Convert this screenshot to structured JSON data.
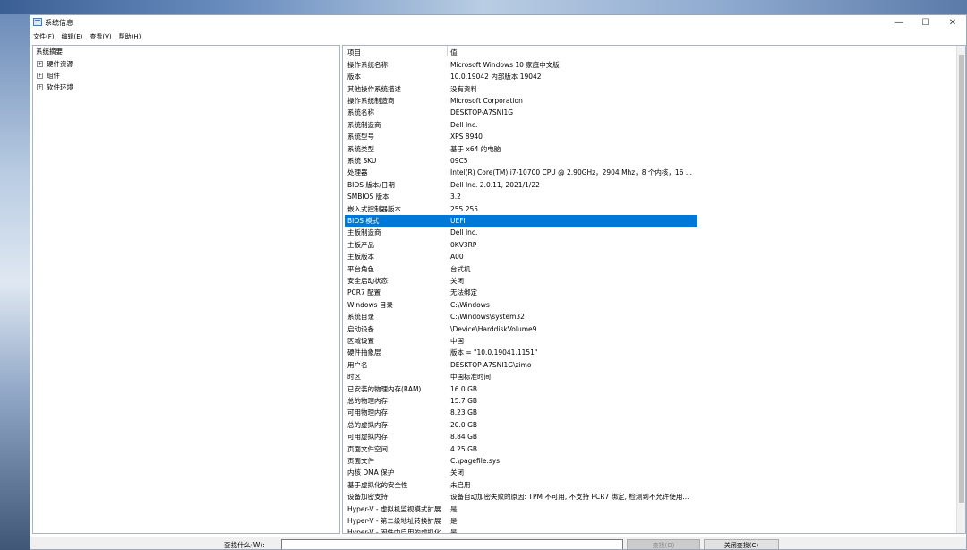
{
  "window": {
    "title": "系统信息",
    "controls": {
      "minimize": "—",
      "maximize": "☐",
      "close": "✕"
    }
  },
  "menu": [
    "文件(F)",
    "编辑(E)",
    "查看(V)",
    "帮助(H)"
  ],
  "tree": {
    "root": "系统摘要",
    "children": [
      "硬件资源",
      "组件",
      "软件环境"
    ],
    "expander": "+"
  },
  "table": {
    "headers": {
      "key": "项目",
      "value": "值"
    },
    "selected_index": 13,
    "rows": [
      [
        "操作系统名称",
        "Microsoft Windows 10 家庭中文版"
      ],
      [
        "版本",
        "10.0.19042 内部版本 19042"
      ],
      [
        "其他操作系统描述",
        "没有资料"
      ],
      [
        "操作系统制造商",
        "Microsoft Corporation"
      ],
      [
        "系统名称",
        "DESKTOP-A7SNI1G"
      ],
      [
        "系统制造商",
        "Dell Inc."
      ],
      [
        "系统型号",
        "XPS 8940"
      ],
      [
        "系统类型",
        "基于 x64 的电脑"
      ],
      [
        "系统 SKU",
        "09C5"
      ],
      [
        "处理器",
        "Intel(R) Core(TM) i7-10700 CPU @ 2.90GHz，2904 Mhz，8 个内核，16 ..."
      ],
      [
        "BIOS 版本/日期",
        "Dell Inc. 2.0.11, 2021/1/22"
      ],
      [
        "SMBIOS 版本",
        "3.2"
      ],
      [
        "嵌入式控制器版本",
        "255.255"
      ],
      [
        "BIOS 模式",
        "UEFI"
      ],
      [
        "主板制造商",
        "Dell Inc."
      ],
      [
        "主板产品",
        "0KV3RP"
      ],
      [
        "主板版本",
        "A00"
      ],
      [
        "平台角色",
        "台式机"
      ],
      [
        "安全启动状态",
        "关闭"
      ],
      [
        "PCR7 配置",
        "无法绑定"
      ],
      [
        "Windows 目录",
        "C:\\Windows"
      ],
      [
        "系统目录",
        "C:\\Windows\\system32"
      ],
      [
        "启动设备",
        "\\Device\\HarddiskVolume9"
      ],
      [
        "区域设置",
        "中国"
      ],
      [
        "硬件抽象层",
        "版本 = \"10.0.19041.1151\""
      ],
      [
        "用户名",
        "DESKTOP-A7SNI1G\\zimo"
      ],
      [
        "时区",
        "中国标准时间"
      ],
      [
        "已安装的物理内存(RAM)",
        "16.0 GB"
      ],
      [
        "总的物理内存",
        "15.7 GB"
      ],
      [
        "可用物理内存",
        "8.23 GB"
      ],
      [
        "总的虚拟内存",
        "20.0 GB"
      ],
      [
        "可用虚拟内存",
        "8.84 GB"
      ],
      [
        "页面文件空间",
        "4.25 GB"
      ],
      [
        "页面文件",
        "C:\\pagefile.sys"
      ],
      [
        "内核 DMA 保护",
        "关闭"
      ],
      [
        "基于虚拟化的安全性",
        "未启用"
      ],
      [
        "设备加密支持",
        "设备自动加密失败的原因: TPM 不可用, 不支持 PCR7 绑定, 检测到不允许使用..."
      ],
      [
        "Hyper-V - 虚拟机监视模式扩展",
        "是"
      ],
      [
        "Hyper-V - 第二级地址转换扩展",
        "是"
      ],
      [
        "Hyper-V - 固件中启用的虚拟化",
        "是"
      ]
    ]
  },
  "find": {
    "label": "查找什么(W):",
    "value": "",
    "find_button": "查找(D)",
    "close_button": "关闭查找(C)"
  }
}
